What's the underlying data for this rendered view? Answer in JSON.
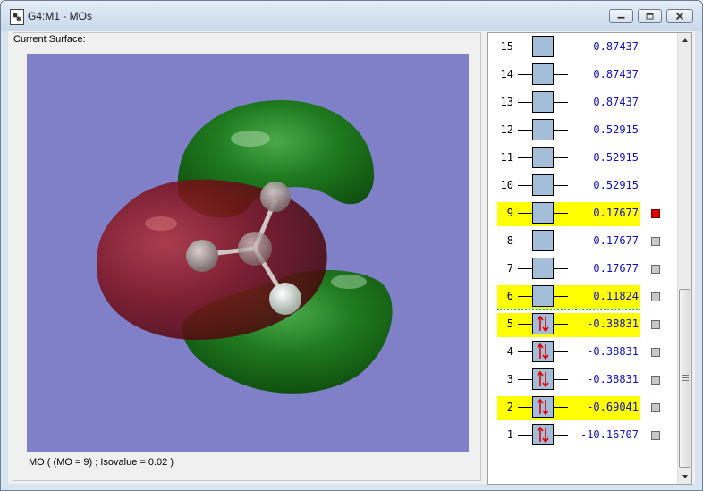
{
  "window": {
    "title": "G4:M1 - MOs"
  },
  "left_panel": {
    "surface_label": "Current Surface:",
    "status": "MO ( (MO = 9) ; Isovalue = 0.02 )"
  },
  "colors": {
    "viewport_bg": "#8080c8",
    "highlight": "#ffff00",
    "energy_text": "#1010c0",
    "mo_box": "#a4bed9",
    "selected_check": "#e00000",
    "positive_lobe": "#1f7a1f",
    "negative_lobe": "#7a0e18"
  },
  "orbitals": [
    {
      "num": "15",
      "energy": "0.87437",
      "occupied": false,
      "highlight": false,
      "selected": false,
      "has_check": false
    },
    {
      "num": "14",
      "energy": "0.87437",
      "occupied": false,
      "highlight": false,
      "selected": false,
      "has_check": false
    },
    {
      "num": "13",
      "energy": "0.87437",
      "occupied": false,
      "highlight": false,
      "selected": false,
      "has_check": false
    },
    {
      "num": "12",
      "energy": "0.52915",
      "occupied": false,
      "highlight": false,
      "selected": false,
      "has_check": false
    },
    {
      "num": "11",
      "energy": "0.52915",
      "occupied": false,
      "highlight": false,
      "selected": false,
      "has_check": false
    },
    {
      "num": "10",
      "energy": "0.52915",
      "occupied": false,
      "highlight": false,
      "selected": false,
      "has_check": false
    },
    {
      "num": "9",
      "energy": "0.17677",
      "occupied": false,
      "highlight": true,
      "selected": true,
      "has_check": true
    },
    {
      "num": "8",
      "energy": "0.17677",
      "occupied": false,
      "highlight": false,
      "selected": false,
      "has_check": true
    },
    {
      "num": "7",
      "energy": "0.17677",
      "occupied": false,
      "highlight": false,
      "selected": false,
      "has_check": true
    },
    {
      "num": "6",
      "energy": "0.11824",
      "occupied": false,
      "highlight": true,
      "selected": false,
      "has_check": true
    },
    {
      "num": "5",
      "energy": "-0.38831",
      "occupied": true,
      "highlight": true,
      "selected": false,
      "has_check": true
    },
    {
      "num": "4",
      "energy": "-0.38831",
      "occupied": true,
      "highlight": false,
      "selected": false,
      "has_check": true
    },
    {
      "num": "3",
      "energy": "-0.38831",
      "occupied": true,
      "highlight": false,
      "selected": false,
      "has_check": true
    },
    {
      "num": "2",
      "energy": "-0.69041",
      "occupied": true,
      "highlight": true,
      "selected": false,
      "has_check": true
    },
    {
      "num": "1",
      "energy": "-10.16707",
      "occupied": true,
      "highlight": false,
      "selected": false,
      "has_check": true
    }
  ],
  "icons": {
    "app": "gaussview-document-icon",
    "minimize": "minimize-icon",
    "maximize": "maximize-icon",
    "close": "close-icon",
    "scroll_up": "chevron-up-icon",
    "scroll_down": "chevron-down-icon",
    "electron_pair": "spin-pair-icon"
  }
}
